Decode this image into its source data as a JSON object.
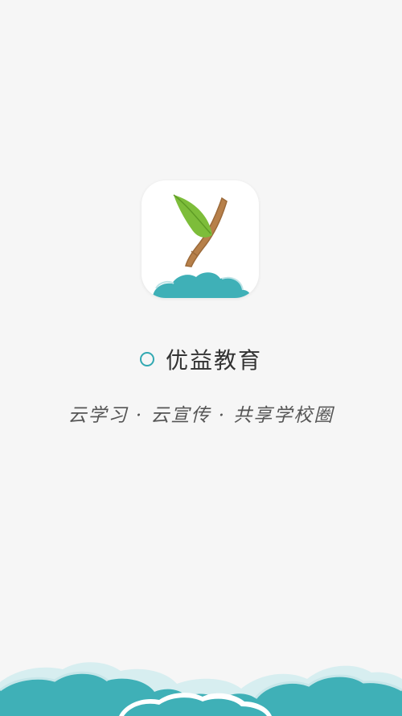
{
  "app": {
    "name": "优益教育",
    "slogan": "云学习 · 云宣传 · 共享学校圈"
  },
  "colors": {
    "background": "#f6f6f6",
    "accent": "#32a9b2",
    "leaf": "#7dbd3a",
    "stem": "#b7804a"
  },
  "icons": {
    "logo": "youyi-y-sprout-logo",
    "title_marker": "circle-outline-icon",
    "decor": "cloud-decoration"
  }
}
